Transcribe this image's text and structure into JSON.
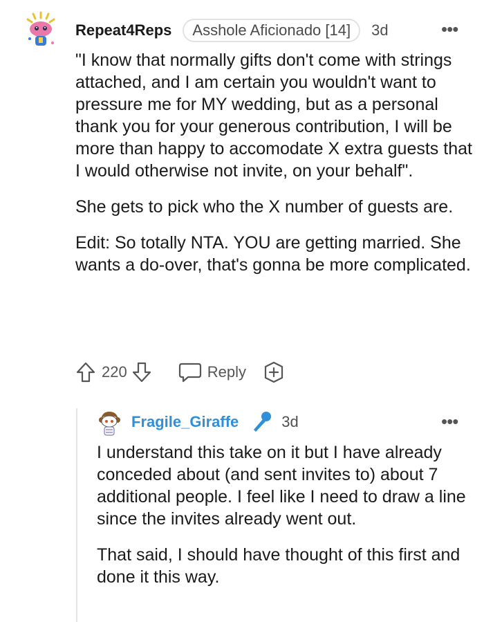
{
  "comment": {
    "username": "Repeat4Reps",
    "flair": "Asshole Aficionado [14]",
    "time": "3d",
    "more_label": "•••",
    "paragraphs": [
      "\"I know that normally gifts don't come with strings attached, and I am certain you wouldn't want to pressure me for MY wedding, but as a personal thank you for your generous contribution, I will be more than happy to accomodate X extra guests that I would otherwise not invite, on your behalf\".",
      "She gets to pick who the X number of guests are.",
      "Edit: So totally NTA. YOU are getting married. She wants a do-over, that's gonna be more complicated."
    ],
    "votes": "220",
    "reply_label": "Reply"
  },
  "reply": {
    "username": "Fragile_Giraffe",
    "time": "3d",
    "more_label": "•••",
    "paragraphs": [
      "I understand this take on it but I have already conceded about (and sent invites to) about 7 additional people. I feel like I need to draw a line since the invites already went out.",
      "That said, I should have thought of this first and done it this way."
    ]
  },
  "colors": {
    "text": "#1a1a1b",
    "meta": "#4f4f4f",
    "op_username": "#2f8fd8",
    "mic_icon": "#2f8fd8"
  },
  "icons": [
    "avatar-snoo-icon",
    "upvote-icon",
    "downvote-icon",
    "comment-bubble-icon",
    "award-plus-icon",
    "mic-icon",
    "more-options-icon"
  ]
}
